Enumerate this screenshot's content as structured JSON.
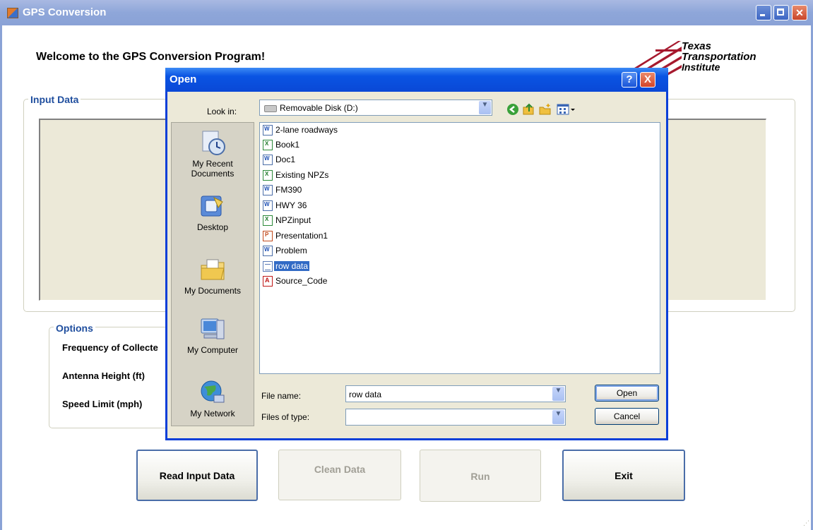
{
  "window": {
    "title": "GPS Conversion"
  },
  "welcome": "Welcome to the GPS Conversion Program!",
  "logo": {
    "line1": "Texas",
    "line2": "Transportation",
    "line3": "Institute",
    "color": "#a6192e"
  },
  "input_group": {
    "title": "Input Data"
  },
  "options_group": {
    "title": "Options",
    "labels": [
      "Frequency of Collecte",
      "Antenna Height (ft)",
      "Speed Limit (mph)"
    ]
  },
  "buttons": {
    "read": "Read Input Data",
    "clean": "Clean Data",
    "run": "Run",
    "exit": "Exit"
  },
  "dialog": {
    "title": "Open",
    "help": "?",
    "close": "X",
    "look_in_label": "Look in:",
    "look_in_value": "Removable Disk (D:)",
    "places": [
      "My Recent Documents",
      "Desktop",
      "My Documents",
      "My Computer",
      "My Network"
    ],
    "places_recent_line1": "My Recent",
    "places_recent_line2": "Documents",
    "files": [
      {
        "name": "2-lane roadways",
        "type": "word"
      },
      {
        "name": "Book1",
        "type": "excel"
      },
      {
        "name": "Doc1",
        "type": "word"
      },
      {
        "name": "Existing NPZs",
        "type": "excel"
      },
      {
        "name": "FM390",
        "type": "word"
      },
      {
        "name": "HWY 36",
        "type": "word"
      },
      {
        "name": "NPZinput",
        "type": "excel"
      },
      {
        "name": "Presentation1",
        "type": "ppt"
      },
      {
        "name": "Problem",
        "type": "word"
      },
      {
        "name": "row data",
        "type": "txt",
        "selected": true
      },
      {
        "name": "Source_Code",
        "type": "pdf"
      }
    ],
    "file_name_label": "File name:",
    "file_name_value": "row data",
    "file_type_label": "Files of type:",
    "file_type_value": "",
    "open_button": "Open",
    "cancel_button": "Cancel"
  },
  "colors": {
    "title_blue": "#0a54e3",
    "group_title": "#1f4e9e",
    "selection": "#316ac5"
  }
}
